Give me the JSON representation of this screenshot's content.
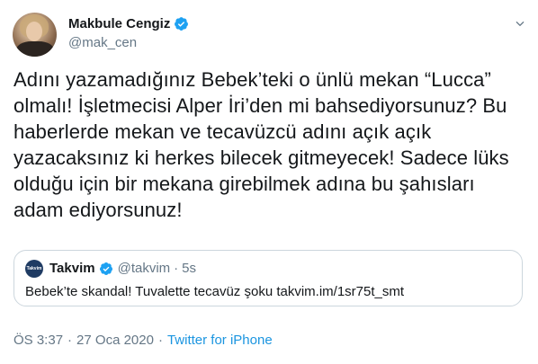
{
  "author": {
    "name": "Makbule Cengiz",
    "handle": "@mak_cen"
  },
  "tweet": {
    "text": "Adını yazamadığınız Bebek’teki o ünlü mekan “Lucca” olmalı! İşletmecisi Alper İri’den mi bahsediyorsunuz? Bu haberlerde mekan ve tecavüzcü adını açık açık yazacaksınız ki herkes bilecek gitmeyecek! Sadece lüks olduğu için bir mekana girebilmek adına bu şahısları adam ediyorsunuz!"
  },
  "quoted": {
    "avatar_text": "Takvim",
    "name": "Takvim",
    "handle": "@takvim",
    "separator": "·",
    "time": "5s",
    "text": "Bebek’te skandal! Tuvalette tecavüz şoku takvim.im/1sr75t_smt"
  },
  "meta": {
    "time": "ÖS 3:37",
    "separator": "·",
    "date": "27 Oca 2020",
    "source": "Twitter for iPhone"
  },
  "icons": {
    "verified": "verified-badge-icon",
    "chevron": "chevron-down-icon"
  },
  "colors": {
    "link": "#1b95e0",
    "verified": "#1da1f2",
    "secondary_text": "#657786",
    "border": "#ccd6dd"
  }
}
